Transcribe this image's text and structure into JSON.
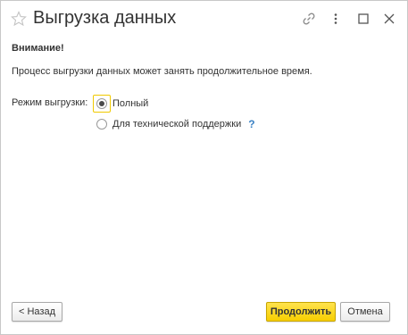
{
  "window": {
    "title": "Выгрузка данных"
  },
  "titlebar": {
    "icons": [
      "star-icon",
      "link-icon",
      "more-icon",
      "maximize-icon",
      "close-icon"
    ]
  },
  "content": {
    "warning_title": "Внимание!",
    "info_text": "Процесс выгрузки данных может занять продолжительное время.",
    "mode_label": "Режим выгрузки:",
    "options": [
      {
        "label": "Полный",
        "selected": true
      },
      {
        "label": "Для технической поддержки",
        "selected": false
      }
    ],
    "help_mark": "?"
  },
  "footer": {
    "back_label": "< Назад",
    "continue_label": "Продолжить",
    "cancel_label": "Отмена"
  },
  "colors": {
    "accent_yellow": "#f7ce00",
    "help_blue": "#3b82c4",
    "text": "#333333"
  }
}
